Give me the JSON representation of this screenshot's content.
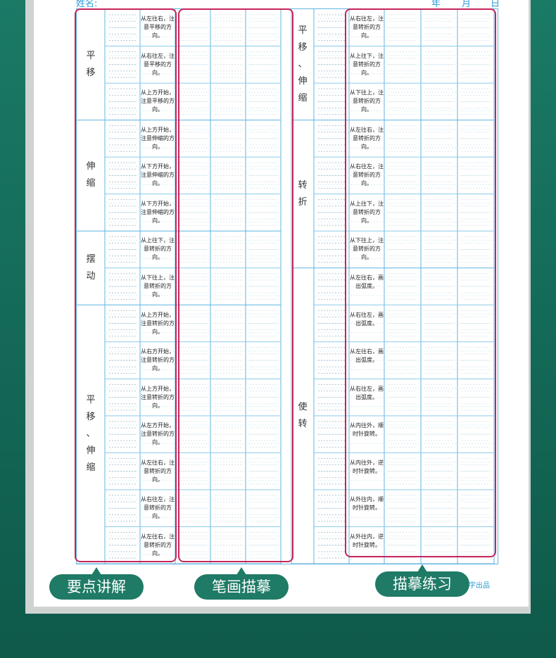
{
  "header": {
    "name_label": "姓名:",
    "date_labels": [
      "年",
      "月",
      "日"
    ]
  },
  "left_groups": [
    {
      "label": "平移",
      "rows": [
        "从左往右，注意平移的方向。",
        "从右往左，注意平移的方向。",
        "从上方开始，注意平移的方向。"
      ]
    },
    {
      "label": "伸缩",
      "rows": [
        "从上方开始，注意伸缩的方向。",
        "从下方开始，注意伸缩的方向。",
        "从下方开始，注意伸缩的方向。"
      ]
    },
    {
      "label": "摆动",
      "rows": [
        "从上往下，注意转折的方向。",
        "从下往上，注意转折的方向。"
      ]
    },
    {
      "label": "平移、伸缩",
      "rows": [
        "从上方开始，注意转折的方向。",
        "从右方开始，注意转折的方向。",
        "从上方开始，注意转折的方向。",
        "从左方开始，注意转折的方向。",
        "从左往右，注意转折的方向。",
        "从右往左，注意转折的方向。",
        "从左往右，注意转折的方向。"
      ]
    }
  ],
  "right_groups": [
    {
      "label": "平移、伸缩",
      "rows": [
        "从右往左，注意转折的方向。",
        "从上往下，注意转折的方向。",
        "从下往上，注意转折的方向。"
      ]
    },
    {
      "label": "转折",
      "rows": [
        "从左往右，注意转折的方向。",
        "从右往左，注意转折的方向。",
        "从上往下，注意转折的方向。",
        "从下往上，注意转折的方向。"
      ]
    },
    {
      "label": "使转",
      "rows": [
        "从左往右，画出弧度。",
        "从右往左，画出弧度。",
        "从左往右，画出弧度。",
        "从右往左，画出弧度。",
        "从内往外，顺时针旋转。",
        "从内往外，逆时针旋转。",
        "从外往内，顺时针旋转。",
        "从外往内，逆时针旋转。"
      ]
    }
  ],
  "callouts": {
    "key_points": "要点讲解",
    "stroke_tracing": "笔画描摹",
    "tracing_practice": "描摹练习"
  },
  "footer_text": "字出品",
  "colors": {
    "accent": "#c8245a",
    "grid": "#5fb4e0",
    "pill": "#1f7a66",
    "background": "#17705f"
  }
}
